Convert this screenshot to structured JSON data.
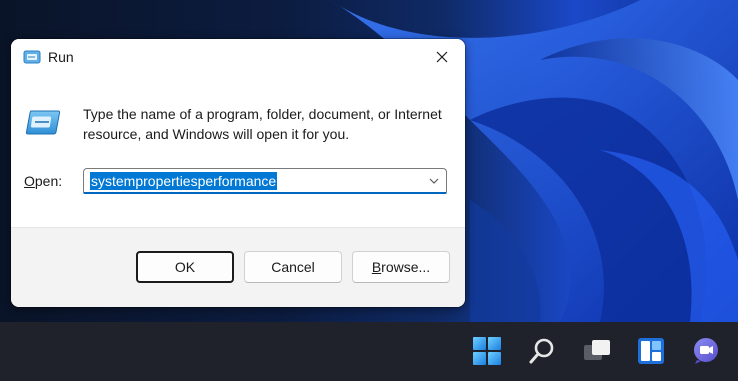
{
  "dialog": {
    "title": "Run",
    "description": "Type the name of a program, folder, document, or Internet resource, and Windows will open it for you.",
    "open_label_prefix": "",
    "open_label_accel": "O",
    "open_label_rest": "pen:",
    "input_value": "systempropertiesperformance",
    "buttons": {
      "ok": "OK",
      "cancel": "Cancel",
      "browse_accel": "B",
      "browse_rest": "rowse..."
    }
  },
  "taskbar": {
    "icons": [
      "start-icon",
      "search-icon",
      "task-view-icon",
      "widgets-icon",
      "chat-icon"
    ]
  },
  "colors": {
    "accent": "#0078d4",
    "taskbar": "#1f222b",
    "wallpaper_blue": "#1a48c8"
  }
}
